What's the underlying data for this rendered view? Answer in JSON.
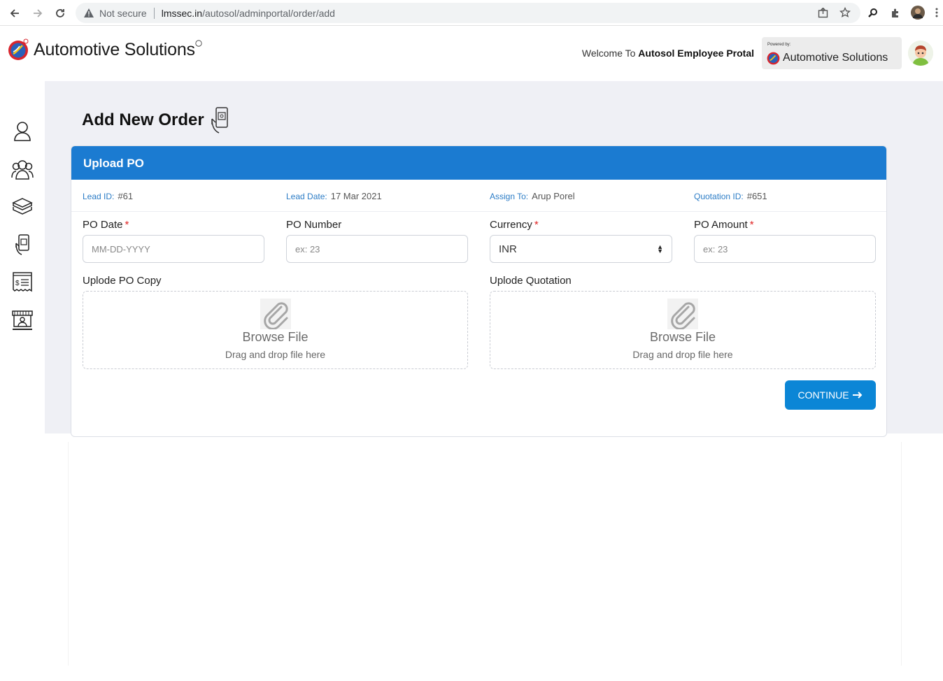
{
  "browser": {
    "security_label": "Not secure",
    "url_host": "lmssec.in",
    "url_path": "/autosol/adminportal/order/add"
  },
  "header": {
    "brand": "Automotive Solutions",
    "welcome_prefix": "Welcome To",
    "welcome_name": "Autosol Employee Protal",
    "powered_by": "Powered by:",
    "powered_brand": "Automotive Solutions"
  },
  "sidebar": {
    "icons": [
      "user-icon",
      "team-icon",
      "box-icon",
      "order-icon",
      "invoice-icon",
      "store-icon"
    ]
  },
  "page": {
    "title": "Add New Order"
  },
  "card": {
    "heading": "Upload PO",
    "info": [
      {
        "key": "Lead ID:",
        "value": "#61"
      },
      {
        "key": "Lead Date:",
        "value": "17 Mar 2021"
      },
      {
        "key": "Assign To:",
        "value": "Arup Porel"
      },
      {
        "key": "Quotation ID:",
        "value": "#651"
      }
    ],
    "fields": {
      "po_date": {
        "label": "PO Date",
        "required": "*",
        "placeholder": "MM-DD-YYYY"
      },
      "po_number": {
        "label": "PO Number",
        "placeholder": "ex: 23"
      },
      "currency": {
        "label": "Currency",
        "required": "*",
        "value": "INR"
      },
      "po_amount": {
        "label": "PO Amount",
        "required": "*",
        "placeholder": "ex: 23"
      }
    },
    "uploads": {
      "po_copy": {
        "label": "Uplode PO Copy",
        "browse": "Browse File",
        "hint": "Drag and drop file here"
      },
      "quotation": {
        "label": "Uplode Quotation",
        "browse": "Browse File",
        "hint": "Drag and drop file here"
      }
    },
    "continue_label": "CONTINUE"
  },
  "colors": {
    "accent": "#1b7bd1",
    "button": "#0b86d6",
    "required": "#e02424"
  }
}
